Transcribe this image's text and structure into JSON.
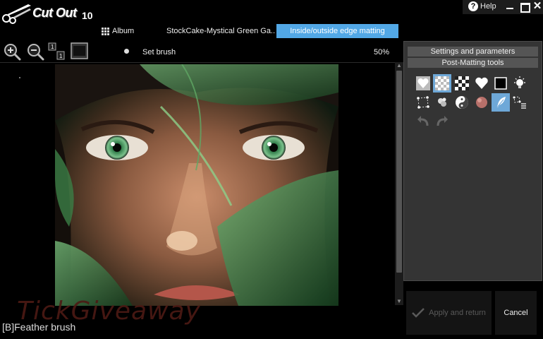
{
  "app": {
    "logo_text": "Cut Out",
    "version": "10"
  },
  "window": {
    "help_label": "Help",
    "help_icon": "question-circle-icon",
    "close_glyph": "✕"
  },
  "tabs": {
    "album_label": "Album",
    "file_label": "StockCake-Mystical Green Ga..",
    "active_label": "Inside/outside edge matting"
  },
  "toolbar": {
    "zoom_in_icon": "zoom-in-icon",
    "zoom_out_icon": "zoom-out-icon",
    "one_to_one_icon": "actual-size-icon",
    "fit_icon": "fit-window-icon",
    "brush_label": "Set brush",
    "zoom_value": "50%"
  },
  "panel": {
    "settings_header": "Settings and parameters",
    "post_matting_header": "Post-Matting tools",
    "tools_row1": [
      "heart-mask-icon",
      "transparency-grid-icon",
      "checker-grid-icon",
      "heart-icon",
      "black-square-icon",
      "lightbulb-icon"
    ],
    "tools_row2": [
      "selection-points-icon",
      "smudge-icon",
      "yin-yang-icon",
      "color-ball-icon",
      "feather-icon",
      "selection-list-icon"
    ],
    "undo_icon": "undo-icon",
    "redo_icon": "redo-icon",
    "selected_tool": "transparency-grid-icon",
    "selected_tool_2": "feather-icon",
    "accent": "#6ea8d8"
  },
  "buttons": {
    "apply_label": "Apply and return",
    "cancel_label": "Cancel"
  },
  "watermark": "TickGiveaway",
  "status_text": "[B]Feather brush",
  "colors": {
    "tab_active": "#52a8e6",
    "panel_bg": "#343434",
    "header_bg": "#555555"
  }
}
